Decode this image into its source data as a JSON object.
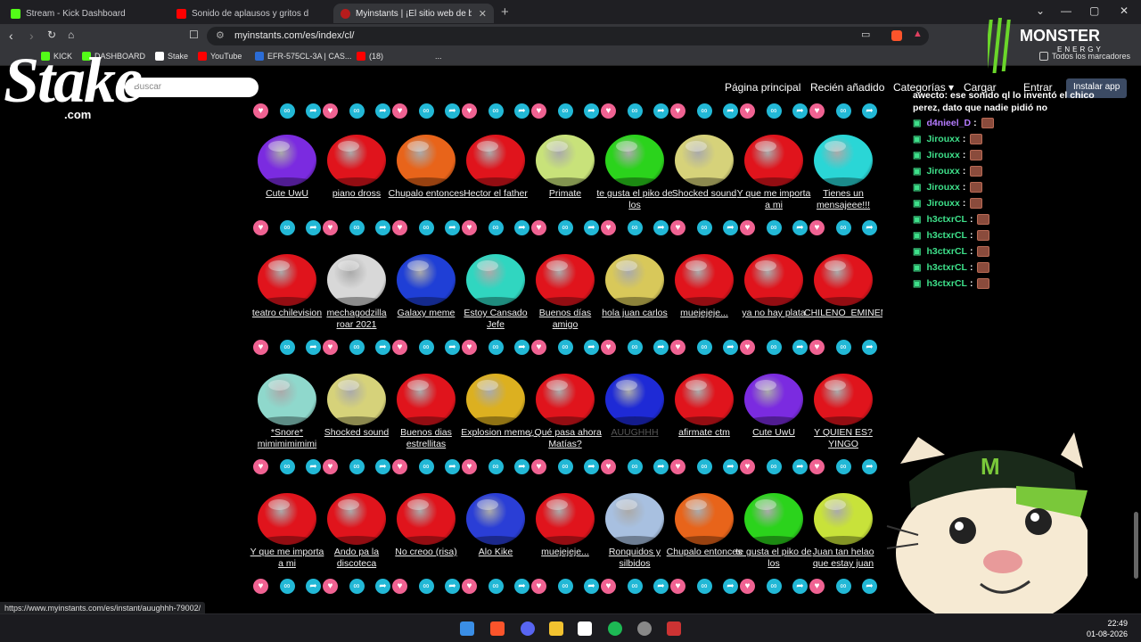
{
  "browser": {
    "tabs": [
      {
        "label": "Stream - Kick Dashboard",
        "color": "#53fc18"
      },
      {
        "label": "Sonido de aplausos y gritos d",
        "color": "#ff0000"
      },
      {
        "label": "Myinstants | ¡El sitio web de b",
        "color": "#b71c1c"
      }
    ],
    "new_tab": "+",
    "window_controls": [
      "⌄",
      "—",
      "▢",
      "✕"
    ],
    "url": "myinstants.com/es/index/cl/",
    "bookmarks": [
      "KICK",
      "DASHBOARD",
      "Stake",
      "YouTube",
      "EFR-575CL-3A | CAS...",
      "(18)",
      "...",
      "Todos los marcadores"
    ]
  },
  "site": {
    "search_placeholder": "Buscar",
    "nav": [
      "Página principal",
      "Recién añadido",
      "Categorías ▾",
      "Cargar",
      "Entrar",
      "Instalar app"
    ]
  },
  "buttons": [
    [
      {
        "label": "Cute UwU",
        "color": "#7b2be0"
      },
      {
        "label": "piano dross",
        "color": "#e0141c"
      },
      {
        "label": "Chupalo entonces",
        "color": "#e8641a"
      },
      {
        "label": "Hector el father",
        "color": "#e0141c"
      },
      {
        "label": "Primate",
        "color": "#c8e27a"
      },
      {
        "label": "te gusta el piko de los",
        "color": "#2bd31c"
      },
      {
        "label": "Shocked sound",
        "color": "#d6d27a"
      },
      {
        "label": "Y que me importa a mi",
        "color": "#e0141c"
      },
      {
        "label": "Tienes un mensajeee!!!",
        "color": "#2ad6d6"
      }
    ],
    [
      {
        "label": "teatro chilevision",
        "color": "#e0141c"
      },
      {
        "label": "mechagodzilla roar 2021",
        "color": "#d8d8d8"
      },
      {
        "label": "Galaxy meme",
        "color": "#1f3fd6"
      },
      {
        "label": "Estoy Cansado Jefe",
        "color": "#30d6c0"
      },
      {
        "label": "Buenos días amigo",
        "color": "#e0141c"
      },
      {
        "label": "hola juan carlos",
        "color": "#d8c85a"
      },
      {
        "label": "muejejeje...",
        "color": "#e0141c"
      },
      {
        "label": "ya no hay plata",
        "color": "#e0141c"
      },
      {
        "label": "CHILENO_EMINEM",
        "color": "#e0141c"
      }
    ],
    [
      {
        "label": "*Snore* mimimimimimi",
        "color": "#8fd8cc"
      },
      {
        "label": "Shocked sound",
        "color": "#d6d27a"
      },
      {
        "label": "Buenos dias estrellitas",
        "color": "#e0141c"
      },
      {
        "label": "Explosion meme",
        "color": "#dcb020"
      },
      {
        "label": "¿Qué pasa ahora Matías?",
        "color": "#e0141c"
      },
      {
        "label": "AUUGHHH",
        "color": "#1e2ad6",
        "faded": true
      },
      {
        "label": "afirmate ctm",
        "color": "#e0141c"
      },
      {
        "label": "Cute UwU",
        "color": "#7b2be0"
      },
      {
        "label": "Y QUIEN ES? YINGO",
        "color": "#e0141c"
      }
    ],
    [
      {
        "label": "Y que me importa a mi",
        "color": "#e0141c"
      },
      {
        "label": "Ando pa la discoteca",
        "color": "#e0141c"
      },
      {
        "label": "No creoo (risa)",
        "color": "#e0141c"
      },
      {
        "label": "Alo Kike",
        "color": "#2a3ed6"
      },
      {
        "label": "muejejeje...",
        "color": "#e0141c"
      },
      {
        "label": "Ronquidos y silbidos",
        "color": "#a8c0e0"
      },
      {
        "label": "Chupalo entonces",
        "color": "#e8641a"
      },
      {
        "label": "te gusta el piko de los",
        "color": "#2bd31c"
      },
      {
        "label": "Juan tan helao que estay juan",
        "color": "#c8e23a"
      }
    ]
  ],
  "chat": {
    "header_msg": "awecto: ese sonido ql lo inventó el chico perez, dato que nadie pidió no",
    "lines": [
      {
        "user": "d4nieel_D",
        "color": "#b57bff"
      },
      {
        "user": "Jirouxx",
        "color": "#3ee08a"
      },
      {
        "user": "Jirouxx",
        "color": "#3ee08a"
      },
      {
        "user": "Jirouxx",
        "color": "#3ee08a"
      },
      {
        "user": "Jirouxx",
        "color": "#3ee08a"
      },
      {
        "user": "Jirouxx",
        "color": "#3ee08a"
      },
      {
        "user": "h3ctxrCL",
        "color": "#3ee08a"
      },
      {
        "user": "h3ctxrCL",
        "color": "#3ee08a"
      },
      {
        "user": "h3ctxrCL",
        "color": "#3ee08a"
      },
      {
        "user": "h3ctxrCL",
        "color": "#3ee08a"
      },
      {
        "user": "h3ctxrCL",
        "color": "#3ee08a"
      }
    ]
  },
  "overlay": {
    "stake_logo": "Stake",
    "stake_com": ".com",
    "monster_text": "MONSTER",
    "monster_sub": "ENERGY"
  },
  "status_url": "https://www.myinstants.com/es/instant/auughhh-79002/",
  "taskbar": {
    "time": "22:49",
    "date": "01-08-2026"
  }
}
